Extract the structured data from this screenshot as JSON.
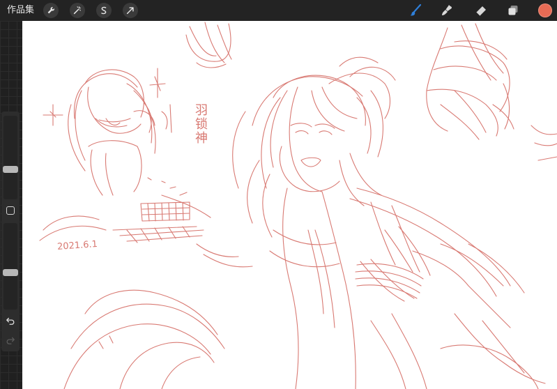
{
  "topbar": {
    "gallery_label": "作品集",
    "left_tools": [
      "wrench-icon",
      "magic-wand-icon",
      "selection-icon",
      "transform-arrow-icon"
    ],
    "right_tools": [
      "brush-icon",
      "smudge-icon",
      "eraser-icon",
      "layers-icon"
    ],
    "active_tool": "brush-icon",
    "active_color": "#e76b55",
    "accent": "#2f7fd9"
  },
  "sidebar": {
    "brush_size": 0.35,
    "brush_opacity": 0.42
  },
  "canvas": {
    "ink_color": "#d2625a",
    "sketch_text_vertical": "羽锁神",
    "sketch_text_date": "2021.6.1"
  }
}
